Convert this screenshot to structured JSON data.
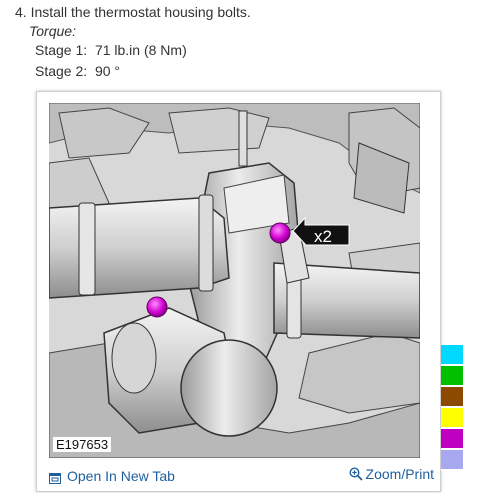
{
  "procedure": {
    "step_heading": "4. Install the thermostat housing bolts.",
    "torque_label": "Torque",
    "torque_colon": ":",
    "stages": [
      {
        "label": "Stage 1:",
        "value": "71 lb.in (8 Nm)"
      },
      {
        "label": "Stage 2:",
        "value": "90 °"
      }
    ]
  },
  "figure": {
    "callout_label": "x2",
    "image_id": "E197653",
    "open_tab_label": "Open In New Tab",
    "open_tab_icon": "open-in-new-tab-icon",
    "zoom_label": "Zoom/Print",
    "zoom_icon": "magnifier-plus-icon",
    "highlight_color": "#c000c0"
  },
  "color_legend": [
    "#00d8ff",
    "#00c000",
    "#8b4a00",
    "#ffff00",
    "#c000c0",
    "#a8a8f0"
  ]
}
